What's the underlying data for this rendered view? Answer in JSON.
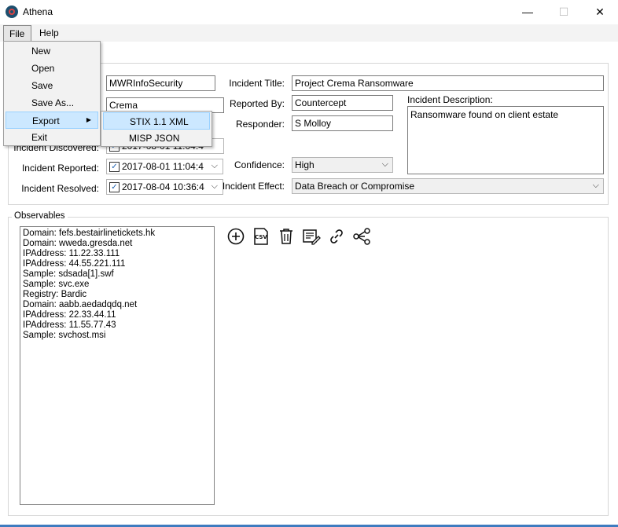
{
  "window": {
    "title": "Athena"
  },
  "window_controls": {
    "minimize": "—",
    "maximize": "☐",
    "close": "✕"
  },
  "menubar": {
    "file": "File",
    "help": "Help"
  },
  "file_menu": {
    "items": [
      "New",
      "Open",
      "Save",
      "Save As...",
      "Export",
      "Exit"
    ],
    "export_submenu": [
      "STIX 1.1 XML",
      "MISP JSON"
    ]
  },
  "incident": {
    "org_value": "MWRInfoSecurity",
    "name_value": "Crema",
    "title_label": "Incident Title:",
    "title_value": "Project Crema Ransomware",
    "reported_by_label": "Reported By:",
    "reported_by_value": "Countercept",
    "responder_label": "Responder:",
    "responder_value": "S Molloy",
    "description_label": "Incident Description:",
    "description_value": "Ransomware found on client estate",
    "discovered_label": "Incident Discovered:",
    "discovered_value": "2017-08-01 11:04:4",
    "reported_label": "Incident Reported:",
    "reported_value": "2017-08-01 11:04:4",
    "resolved_label": "Incident Resolved:",
    "resolved_value": "2017-08-04 10:36:4",
    "confidence_label": "Confidence:",
    "confidence_value": "High",
    "effect_label": "Incident Effect:",
    "effect_value": "Data Breach or Compromise"
  },
  "observables": {
    "label": "Observables",
    "items": [
      "Domain: fefs.bestairlinetickets.hk",
      "Domain: wweda.gresda.net",
      "IPAddress: 11.22.33.111",
      "IPAddress: 44.55.221.111",
      "Sample: sdsada[1].swf",
      "Sample: svc.exe",
      "Registry: Bardic",
      "Domain: aabb.aedadqdq.net",
      "IPAddress: 22.33.44.11",
      "IPAddress: 11.55.77.43",
      "Sample: svchost.msi"
    ],
    "toolbar": {
      "csv_label": "CSV",
      "icons": [
        "add-icon",
        "csv-icon",
        "trash-icon",
        "edit-list-icon",
        "link-icon",
        "share-graph-icon"
      ]
    }
  },
  "colors": {
    "accent": "#3e7bbf",
    "highlight": "#cce8ff"
  }
}
